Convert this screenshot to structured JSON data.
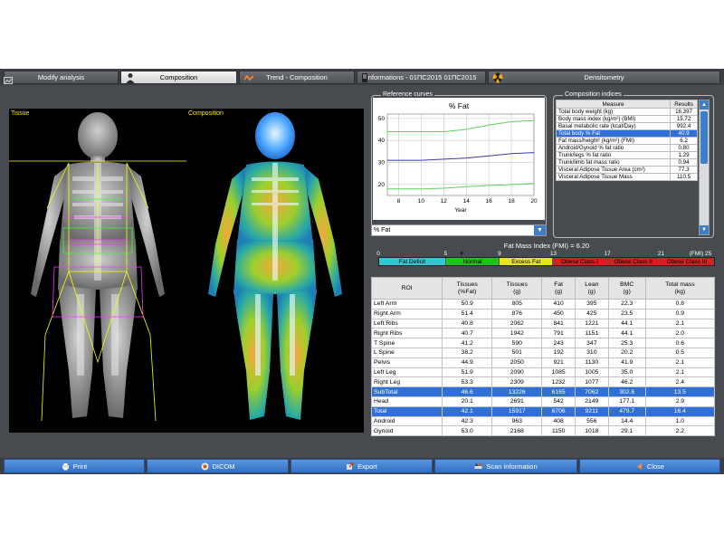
{
  "tabs": [
    {
      "label": "Modify analysis",
      "icon": "none"
    },
    {
      "label": "Composition",
      "icon": "person-icon"
    },
    {
      "label": "Trend - Composition",
      "icon": "trend-icon"
    },
    {
      "label": "Informations - 01ΠC2015 01ΠC2015",
      "icon": "info-icon"
    },
    {
      "label": "Densitometry",
      "icon": "radiation-icon"
    }
  ],
  "panels": {
    "tissue_label": "Tissue",
    "composition_label": "Composition"
  },
  "reference_curves": {
    "title": "Reference curves",
    "select_value": "% Fat",
    "chart_data": {
      "type": "line",
      "title": "% Fat",
      "xlabel": "Year",
      "ylabel": "",
      "xlim": [
        7,
        20
      ],
      "ylim": [
        15,
        52
      ],
      "xticks": [
        8,
        10,
        12,
        14,
        16,
        18,
        20
      ],
      "yticks": [
        20,
        30,
        40,
        50
      ],
      "series": [
        {
          "color": "#5fd35f",
          "x": [
            7,
            10,
            12,
            14,
            16,
            18,
            20
          ],
          "y": [
            44,
            44,
            44,
            45,
            47,
            48.5,
            49
          ]
        },
        {
          "color": "#3b3ba8",
          "x": [
            7,
            10,
            12,
            14,
            16,
            18,
            20
          ],
          "y": [
            31,
            31,
            31.5,
            32,
            33,
            34,
            34.5
          ]
        },
        {
          "color": "#5fd35f",
          "x": [
            7,
            10,
            12,
            14,
            16,
            18,
            20
          ],
          "y": [
            18,
            18,
            18.3,
            19,
            19.5,
            20,
            20.5
          ]
        }
      ],
      "grid": true
    }
  },
  "composition_indices": {
    "title": "Composition indices",
    "headers": [
      "Measure",
      "Results"
    ],
    "rows": [
      {
        "measure": "Total body weight (kg)",
        "result": "16.397"
      },
      {
        "measure": "Body mass index (kg/m²) (BMI)",
        "result": "15.72"
      },
      {
        "measure": "Basal metabolic rate (kcal/Day)",
        "result": "992.4"
      },
      {
        "measure": "Total body % Fat",
        "result": "40.9"
      },
      {
        "measure": "Fat mass/height² (kg/m²) (FMI)",
        "result": "6.2"
      },
      {
        "measure": "Android/Gynoid % fat ratio",
        "result": "0.80"
      },
      {
        "measure": "Trunk/legs % fat ratio",
        "result": "1.29"
      },
      {
        "measure": "Trunk/limb fat mass ratio",
        "result": "0.94"
      },
      {
        "measure": "Visceral Adipose Tissue Area (cm²)",
        "result": "77.3"
      },
      {
        "measure": "Visceral Adipose Tissue Mass",
        "result": "110.5"
      }
    ],
    "selected_index": 3
  },
  "fmi": {
    "title": "Fat Mass Index (FMI) = 6.20",
    "value": 6.2,
    "ticks": [
      "0",
      "5",
      "9",
      "13",
      "17",
      "21",
      "(FMI) 25"
    ],
    "segments": [
      {
        "label": "Fat Deficit",
        "color": "#33c7d1",
        "from": 0,
        "to": 5
      },
      {
        "label": "Normal",
        "color": "#1fc21f",
        "from": 5,
        "to": 9
      },
      {
        "label": "Excess Fat",
        "color": "#e6e61a",
        "from": 9,
        "to": 13
      },
      {
        "label": "Obese Class I",
        "color": "#d81e1e",
        "from": 13,
        "to": 17
      },
      {
        "label": "Obese Class II",
        "color": "#d81e1e",
        "from": 17,
        "to": 21
      },
      {
        "label": "Obese Class III",
        "color": "#d81e1e",
        "from": 21,
        "to": 25
      }
    ]
  },
  "roi_table": {
    "headers": [
      "ROI",
      "Tissues\n(%Fat)",
      "Tissues\n(g)",
      "Fat\n(g)",
      "Lean\n(g)",
      "BMC\n(g)",
      "Total mass\n(kg)"
    ],
    "rows": [
      {
        "cells": [
          "Left Arm",
          "50.9",
          "805",
          "410",
          "395",
          "22.3",
          "0.8"
        ],
        "highlight": false
      },
      {
        "cells": [
          "Right Arm",
          "51.4",
          "876",
          "450",
          "425",
          "23.5",
          "0.9"
        ],
        "highlight": false
      },
      {
        "cells": [
          "Left Ribs",
          "40.8",
          "2062",
          "841",
          "1221",
          "44.1",
          "2.1"
        ],
        "highlight": false
      },
      {
        "cells": [
          "Right Ribs",
          "40.7",
          "1942",
          "791",
          "1151",
          "44.1",
          "2.0"
        ],
        "highlight": false
      },
      {
        "cells": [
          "T Spine",
          "41.2",
          "590",
          "243",
          "347",
          "25.3",
          "0.6"
        ],
        "highlight": false
      },
      {
        "cells": [
          "L Spine",
          "38.2",
          "501",
          "192",
          "310",
          "20.2",
          "0.5"
        ],
        "highlight": false
      },
      {
        "cells": [
          "Pelvis",
          "44.9",
          "2050",
          "921",
          "1130",
          "41.9",
          "2.1"
        ],
        "highlight": false
      },
      {
        "cells": [
          "Left Leg",
          "51.9",
          "2090",
          "1085",
          "1005",
          "35.0",
          "2.1"
        ],
        "highlight": false
      },
      {
        "cells": [
          "Right Leg",
          "53.3",
          "2309",
          "1232",
          "1077",
          "46.2",
          "2.4"
        ],
        "highlight": false
      },
      {
        "cells": [
          "SubTotal",
          "46.6",
          "13226",
          "6165",
          "7062",
          "302.6",
          "13.5"
        ],
        "highlight": true
      },
      {
        "cells": [
          "Head",
          "20.1",
          "2691",
          "542",
          "2149",
          "177.1",
          "2.9"
        ],
        "highlight": false
      },
      {
        "cells": [
          "Total",
          "42.1",
          "15917",
          "6706",
          "9211",
          "479.7",
          "16.4"
        ],
        "highlight": true
      },
      {
        "cells": [
          "Android",
          "42.3",
          "963",
          "408",
          "556",
          "14.4",
          "1.0"
        ],
        "highlight": false
      },
      {
        "cells": [
          "Gynoid",
          "53.0",
          "2168",
          "1150",
          "1018",
          "29.1",
          "2.2"
        ],
        "highlight": false
      }
    ]
  },
  "bottom_buttons": [
    {
      "label": "Print",
      "icon": "printer-icon"
    },
    {
      "label": "DICOM",
      "icon": "dicom-icon"
    },
    {
      "label": "Export",
      "icon": "export-icon"
    },
    {
      "label": "Scan information",
      "icon": "scanner-icon"
    },
    {
      "label": "Close",
      "icon": "close-icon"
    }
  ]
}
